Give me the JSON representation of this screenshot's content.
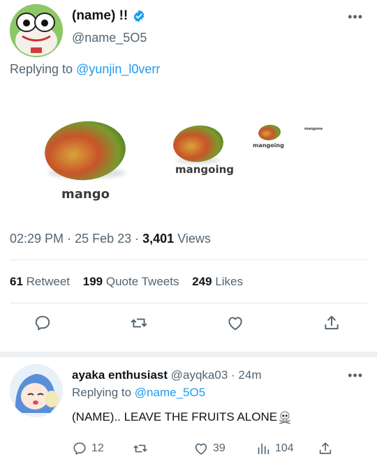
{
  "tweet": {
    "display_name": "(name) !!",
    "handle": "@name_5O5",
    "more_icon": "more-horizontal-icon",
    "replying_prefix": "Replying to",
    "replying_handle": "@yunjin_l0verr",
    "media": {
      "labels": [
        "mango",
        "mangoing",
        "mangoing",
        "mangone"
      ]
    },
    "time": "02:29 PM",
    "date": "25 Feb 23",
    "views_count": "3,401",
    "views_label": "Views",
    "retweets_count": "61",
    "retweets_label": "Retweet",
    "quotes_count": "199",
    "quotes_label": "Quote Tweets",
    "likes_count": "249",
    "likes_label": "Likes",
    "actions": [
      "reply-icon",
      "retweet-icon",
      "like-icon",
      "share-icon"
    ]
  },
  "reply": {
    "display_name": "ayaka enthusiast",
    "handle": "@ayqka03",
    "time": "24m",
    "replying_prefix": "Replying to",
    "replying_handle": "@name_5O5",
    "text": "(NAME).. LEAVE THE FRUITS ALONE",
    "emoji_icon": "skull-and-crossbones-icon",
    "reply_count": "12",
    "like_count": "39",
    "views_count": "104"
  },
  "colors": {
    "link": "#1d9bf0",
    "secondary_text": "#536471",
    "verified": "#1d9bf0"
  }
}
